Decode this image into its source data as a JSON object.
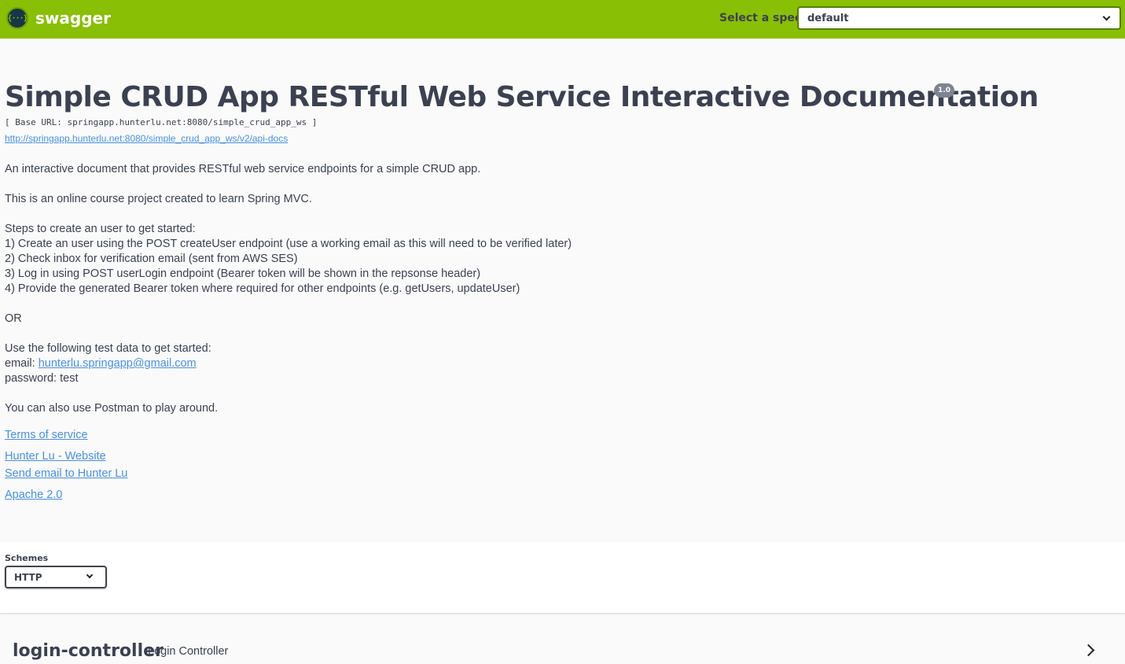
{
  "topbar": {
    "logo_glyph": "{···}",
    "brand": "swagger",
    "spec_label": "Select a spec",
    "spec_value": "default",
    "color": "#89bf04"
  },
  "info": {
    "title": "Simple CRUD App RESTful Web Service Interactive Documentation",
    "version": "1.0",
    "base_url": "[ Base URL: springapp.hunterlu.net:8080/simple_crud_app_ws ]",
    "api_docs_url": "http://springapp.hunterlu.net:8080/simple_crud_app_ws/v2/api-docs",
    "description": {
      "p1": "An interactive document that provides RESTful web service endpoints for a simple CRUD app.",
      "p2": "This is an online course project created to learn Spring MVC.",
      "steps_intro": "Steps to create an user to get started:",
      "step1": "1) Create an user using the POST createUser endpoint (use a working email as this will need to be verified later)",
      "step2": "2) Check inbox for verification email (sent from AWS SES)",
      "step3": "3) Log in using POST userLogin endpoint (Bearer token will be shown in the repsonse header)",
      "step4": "4) Provide the generated Bearer token where required for other endpoints (e.g. getUsers, updateUser)",
      "or": "OR",
      "test_intro": "Use the following test data to get started:",
      "email_label": "email: ",
      "email_value": "hunterlu.springapp@gmail.com",
      "password": "password: test",
      "postman": "You can also use Postman to play around."
    },
    "links": {
      "terms": "Terms of service",
      "website": "Hunter Lu - Website",
      "email": "Send email to Hunter Lu",
      "license": "Apache 2.0"
    }
  },
  "schemes": {
    "label": "Schemes",
    "value": "HTTP"
  },
  "controllers": [
    {
      "name": "login-controller",
      "description": "Login Controller"
    }
  ]
}
